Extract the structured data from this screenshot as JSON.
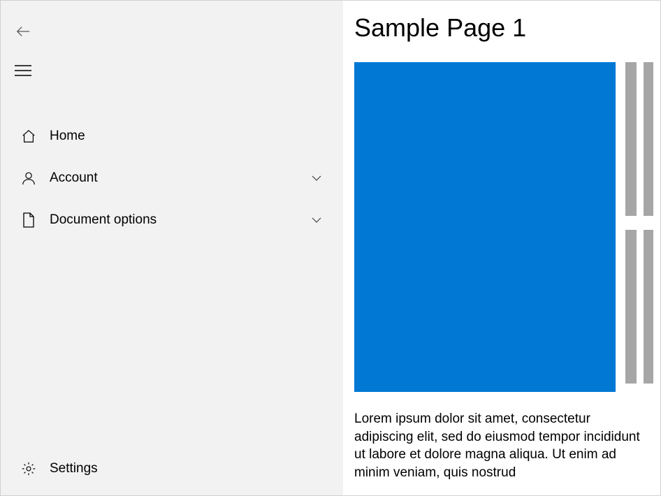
{
  "sidebar": {
    "items": [
      {
        "label": "Home",
        "icon": "home-icon",
        "expandable": false
      },
      {
        "label": "Account",
        "icon": "person-icon",
        "expandable": true
      },
      {
        "label": "Document options",
        "icon": "document-icon",
        "expandable": true
      }
    ],
    "settings_label": "Settings"
  },
  "main": {
    "title": "Sample Page 1",
    "body": "Lorem ipsum dolor sit amet, consectetur adipiscing elit, sed do eiusmod tempor incididunt ut labore et dolore magna aliqua. Ut enim ad minim veniam, quis nostrud",
    "hero_color": "#0078d4"
  }
}
